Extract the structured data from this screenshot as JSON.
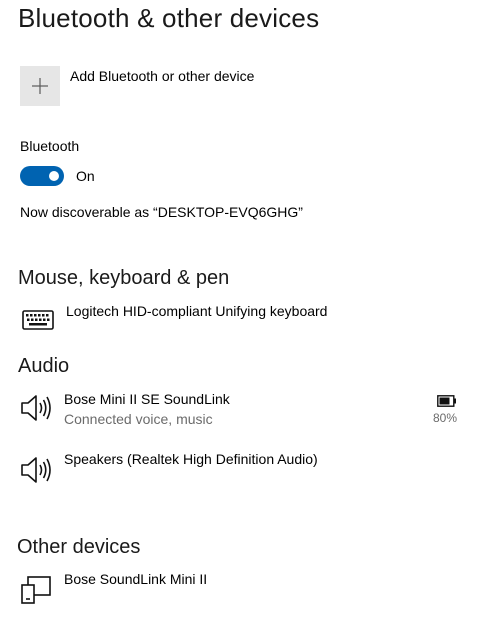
{
  "page": {
    "title": "Bluetooth & other devices"
  },
  "add_device": {
    "label": "Add Bluetooth or other device",
    "icon": "plus-icon"
  },
  "bluetooth": {
    "label": "Bluetooth",
    "toggle_state": "On",
    "toggle_on": true,
    "discoverable_text": "Now discoverable as “DESKTOP-EVQ6GHG”",
    "accent_color": "#0063b1"
  },
  "sections": {
    "mouse_keyboard_pen": {
      "title": "Mouse, keyboard & pen",
      "devices": [
        {
          "name": "Logitech HID-compliant Unifying keyboard",
          "icon": "keyboard-icon"
        }
      ]
    },
    "audio": {
      "title": "Audio",
      "devices": [
        {
          "name": "Bose Mini II SE SoundLink",
          "status": "Connected voice, music",
          "battery": "80%",
          "battery_level": 0.8,
          "icon": "speaker-icon"
        },
        {
          "name": "Speakers (Realtek High Definition Audio)",
          "icon": "speaker-icon"
        }
      ]
    },
    "other_devices": {
      "title": "Other devices",
      "devices": [
        {
          "name": "Bose SoundLink Mini II",
          "icon": "device-icon"
        }
      ]
    }
  }
}
